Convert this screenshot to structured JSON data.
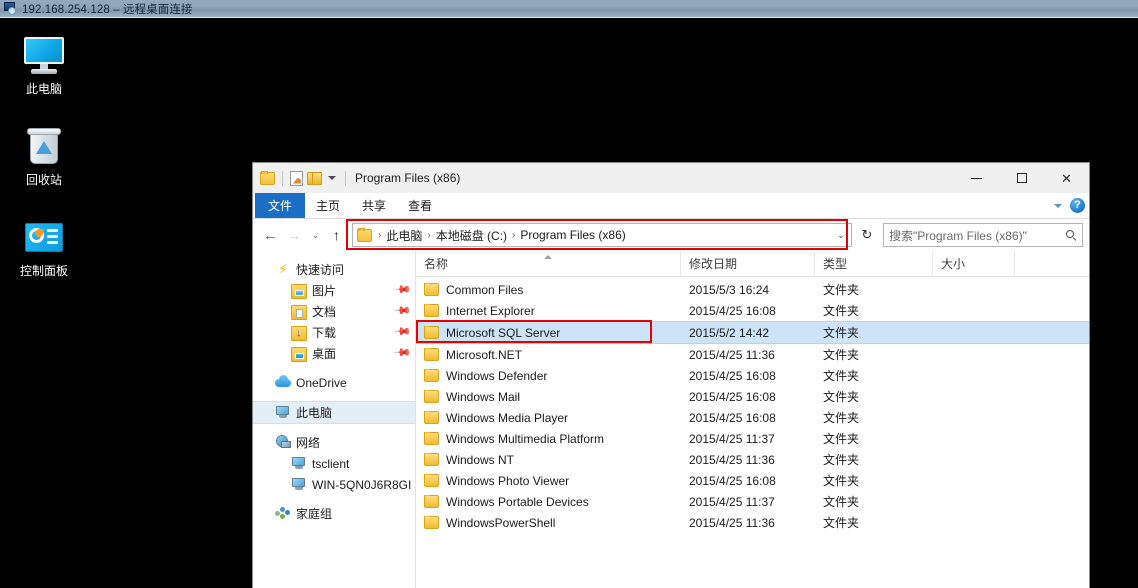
{
  "rdp": {
    "title": "192.168.254.128 – 远程桌面连接",
    "icon": "remote-desktop-icon"
  },
  "desktop": {
    "icons": [
      {
        "label": "此电脑",
        "icon": "this-pc-icon"
      },
      {
        "label": "回收站",
        "icon": "recycle-bin-icon"
      },
      {
        "label": "控制面板",
        "icon": "control-panel-icon"
      }
    ]
  },
  "explorer": {
    "title": "Program Files (x86)",
    "quick_access_toolbar": [
      {
        "icon": "folder-icon",
        "name": "explorer-system-menu"
      },
      {
        "icon": "properties-icon",
        "name": "qat-properties"
      },
      {
        "icon": "new-folder-icon",
        "name": "qat-new-folder"
      },
      {
        "icon": "chevron-down-icon",
        "name": "qat-customize"
      }
    ],
    "window_controls": {
      "minimize": "–",
      "maximize": "□",
      "close": "✕"
    },
    "ribbon": {
      "tabs": [
        {
          "label": "文件",
          "active": true
        },
        {
          "label": "主页",
          "active": false
        },
        {
          "label": "共享",
          "active": false
        },
        {
          "label": "查看",
          "active": false
        }
      ],
      "expand_icon": "chevron-down-icon",
      "help_label": "?"
    },
    "nav": {
      "back": "←",
      "forward": "→",
      "recent": "⌄",
      "up": "↑",
      "refresh": "↻",
      "dropdown": "⌄"
    },
    "breadcrumb": {
      "items": [
        "此电脑",
        "本地磁盘 (C:)",
        "Program Files (x86)"
      ],
      "separator": "›",
      "highlight_color": "#e60000"
    },
    "search": {
      "placeholder": "搜索\"Program Files (x86)\"",
      "icon": "search-icon"
    },
    "sidebar": {
      "items": [
        {
          "label": "快速访问",
          "icon": "quick-access-icon",
          "level": 0,
          "pinned": false,
          "selected": false
        },
        {
          "label": "图片",
          "icon": "pictures-folder-icon",
          "level": 1,
          "pinned": true,
          "selected": false
        },
        {
          "label": "文档",
          "icon": "documents-folder-icon",
          "level": 1,
          "pinned": true,
          "selected": false
        },
        {
          "label": "下载",
          "icon": "downloads-folder-icon",
          "level": 1,
          "pinned": true,
          "selected": false
        },
        {
          "label": "桌面",
          "icon": "desktop-folder-icon",
          "level": 1,
          "pinned": true,
          "selected": false
        },
        {
          "label": "OneDrive",
          "icon": "onedrive-icon",
          "level": 0,
          "pinned": false,
          "selected": false
        },
        {
          "label": "此电脑",
          "icon": "this-pc-icon",
          "level": 0,
          "pinned": false,
          "selected": true
        },
        {
          "label": "网络",
          "icon": "network-icon",
          "level": 0,
          "pinned": false,
          "selected": false
        },
        {
          "label": "tsclient",
          "icon": "computer-icon",
          "level": 1,
          "pinned": false,
          "selected": false
        },
        {
          "label": "WIN-5QN0J6R8GI",
          "icon": "computer-icon",
          "level": 1,
          "pinned": false,
          "selected": false
        },
        {
          "label": "家庭组",
          "icon": "homegroup-icon",
          "level": 0,
          "pinned": false,
          "selected": false
        }
      ]
    },
    "columns": [
      {
        "label": "名称",
        "sorted": "asc"
      },
      {
        "label": "修改日期",
        "sorted": ""
      },
      {
        "label": "类型",
        "sorted": ""
      },
      {
        "label": "大小",
        "sorted": ""
      }
    ],
    "files": [
      {
        "name": "Common Files",
        "date": "2015/5/3 16:24",
        "type": "文件夹",
        "size": "",
        "selected": false,
        "highlighted": false
      },
      {
        "name": "Internet Explorer",
        "date": "2015/4/25 16:08",
        "type": "文件夹",
        "size": "",
        "selected": false,
        "highlighted": false
      },
      {
        "name": "Microsoft SQL Server",
        "date": "2015/5/2 14:42",
        "type": "文件夹",
        "size": "",
        "selected": true,
        "highlighted": true
      },
      {
        "name": "Microsoft.NET",
        "date": "2015/4/25 11:36",
        "type": "文件夹",
        "size": "",
        "selected": false,
        "highlighted": false
      },
      {
        "name": "Windows Defender",
        "date": "2015/4/25 16:08",
        "type": "文件夹",
        "size": "",
        "selected": false,
        "highlighted": false
      },
      {
        "name": "Windows Mail",
        "date": "2015/4/25 16:08",
        "type": "文件夹",
        "size": "",
        "selected": false,
        "highlighted": false
      },
      {
        "name": "Windows Media Player",
        "date": "2015/4/25 16:08",
        "type": "文件夹",
        "size": "",
        "selected": false,
        "highlighted": false
      },
      {
        "name": "Windows Multimedia Platform",
        "date": "2015/4/25 11:37",
        "type": "文件夹",
        "size": "",
        "selected": false,
        "highlighted": false
      },
      {
        "name": "Windows NT",
        "date": "2015/4/25 11:36",
        "type": "文件夹",
        "size": "",
        "selected": false,
        "highlighted": false
      },
      {
        "name": "Windows Photo Viewer",
        "date": "2015/4/25 16:08",
        "type": "文件夹",
        "size": "",
        "selected": false,
        "highlighted": false
      },
      {
        "name": "Windows Portable Devices",
        "date": "2015/4/25 11:37",
        "type": "文件夹",
        "size": "",
        "selected": false,
        "highlighted": false
      },
      {
        "name": "WindowsPowerShell",
        "date": "2015/4/25 11:36",
        "type": "文件夹",
        "size": "",
        "selected": false,
        "highlighted": false
      }
    ]
  }
}
